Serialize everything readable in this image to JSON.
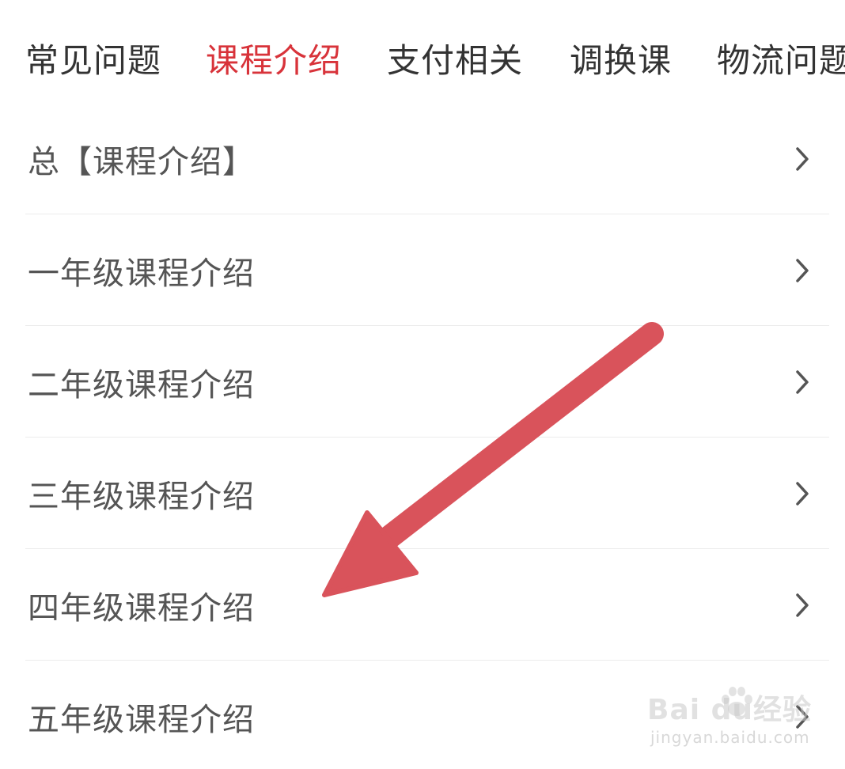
{
  "tabs": [
    {
      "label": "常见问题",
      "active": false
    },
    {
      "label": "课程介绍",
      "active": true
    },
    {
      "label": "支付相关",
      "active": false
    },
    {
      "label": "调换课",
      "active": false
    },
    {
      "label": "物流问题",
      "active": false
    }
  ],
  "list": {
    "items": [
      {
        "label": "总【课程介绍】"
      },
      {
        "label": "一年级课程介绍"
      },
      {
        "label": "二年级课程介绍"
      },
      {
        "label": "三年级课程介绍"
      },
      {
        "label": "四年级课程介绍"
      },
      {
        "label": "五年级课程介绍"
      }
    ]
  },
  "colors": {
    "active_tab": "#d8333a",
    "text": "#333333",
    "list_text": "#555555",
    "annotation_arrow": "#d9535b"
  },
  "icons": {
    "chevron": "chevron-right-icon",
    "arrow": "annotation-arrow-icon",
    "watermark": "baidu-paw-icon"
  },
  "watermark": {
    "brand": "Bai du经验",
    "url": "jingyan.baidu.com"
  }
}
